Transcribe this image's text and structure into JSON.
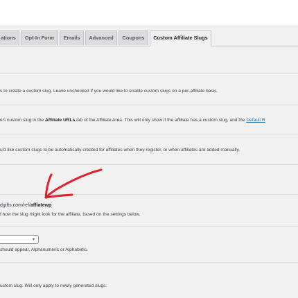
{
  "tabs": [
    {
      "label": "ations"
    },
    {
      "label": "Opt-In Form"
    },
    {
      "label": "Emails"
    },
    {
      "label": "Advanced"
    },
    {
      "label": "Coupons"
    },
    {
      "label": "Custom Affiliate Slugs"
    }
  ],
  "settings": {
    "custom_slug_text": "s to create a custom slug. Leave unchecked if you would like to enable custom slugs on a per-affiliate basis.",
    "show_slug": {
      "prefix": "e's custom slug in the ",
      "bold": "Affiliate URLs",
      "middle": " tab of the Affiliate Area. This will only show if the affiliate has a custom slug, and the ",
      "link": "Default R"
    },
    "auto_create_text": "u'd like custom slugs to be automatically created for affiliates when they register, or when affiliates are added manually.",
    "example_url": {
      "prefix": "dgifts.com/ref/",
      "slug": "affiatewp"
    },
    "example_desc": "f how the slug might look for the affiliate, based on the settings below.",
    "select_chevron": "▾",
    "character_type_desc": "should appear, Alphanumeric or Alphabetic.",
    "length_desc": "ustom slug. Will only apply to newly generated slugs."
  },
  "annotation": {
    "color": "#e2202c"
  }
}
